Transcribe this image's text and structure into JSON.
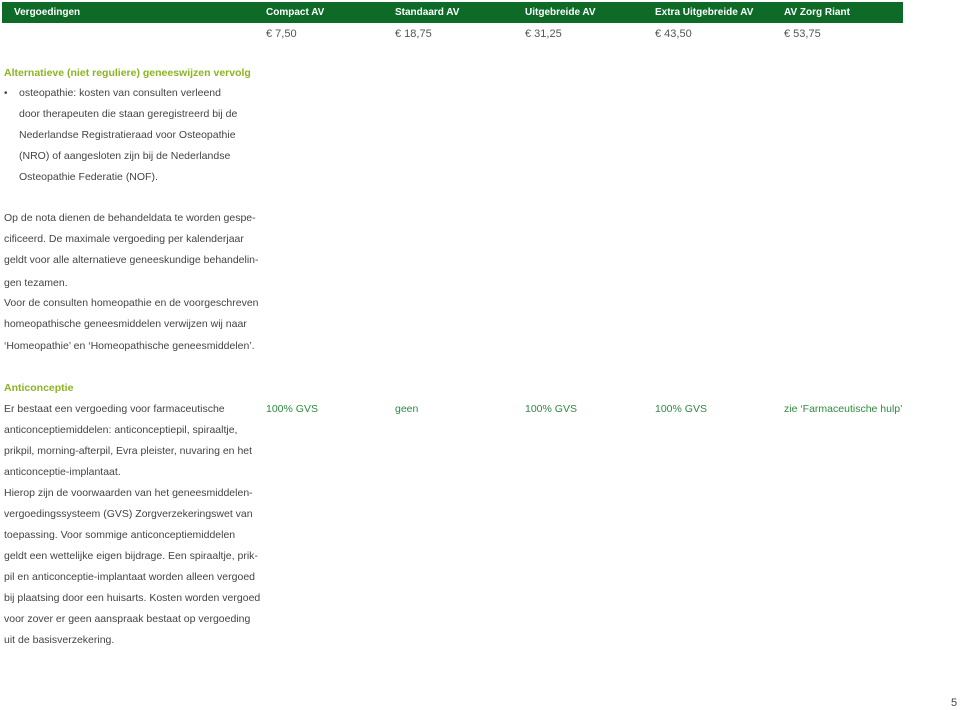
{
  "header": {
    "columns": [
      "Vergoedingen",
      "Compact AV",
      "Standaard AV",
      "Uitgebreide AV",
      "Extra Uitgebreide AV",
      "AV Zorg Riant"
    ],
    "color": "#0d6b27"
  },
  "prices": [
    "€ 7,50",
    "€ 18,75",
    "€ 31,25",
    "€ 43,50",
    "€ 53,75"
  ],
  "section1": {
    "title": "Alternatieve (niet reguliere) geneeswijzen vervolg",
    "bullet_lines": [
      "osteopathie: kosten van consulten verleend",
      "door therapeuten die staan geregistreerd bij de",
      "Nederlandse Registratieraad voor Osteopathie",
      "(NRO) of aangesloten zijn bij de Nederlandse",
      "Osteopathie Federatie (NOF)."
    ],
    "paragraph_lines": [
      "Op de nota dienen de behandeldata te worden gespe-",
      "cificeerd. De maximale vergoeding per kalenderjaar",
      "geldt voor alle alternatieve geneeskundige behandelin-",
      "gen tezamen.",
      "Voor de consulten homeopathie en de voorgeschreven",
      "homeopathische geneesmiddelen verwijzen wij naar",
      "‘Homeopathie’ en ‘Homeopathische geneesmiddelen’."
    ]
  },
  "section2": {
    "title": "Anticonceptie",
    "lines": [
      "Er bestaat een vergoeding voor farmaceutische",
      "anticonceptiemiddelen: anticonceptiepil, spiraaltje,",
      "prikpil, morning-afterpil, Evra pleister, nuvaring en het",
      "anticonceptie-implantaat.",
      "Hierop zijn de voorwaarden van het geneesmiddelen-",
      "vergoedingssysteem (GVS) Zorgverzekeringswet van",
      "toepassing. Voor sommige anticonceptiemiddelen",
      "geldt een wettelijke eigen bijdrage. Een spiraaltje, prik-",
      "pil en anticonceptie-implantaat worden alleen vergoed",
      "bij plaatsing door een huisarts. Kosten worden vergoed",
      "voor zover er geen aanspraak bestaat op vergoeding",
      "uit de basisverzekering."
    ],
    "values": [
      "100% GVS",
      "geen",
      "100% GVS",
      "100% GVS",
      "zie ‘Farmaceutische hulp’"
    ]
  },
  "page_number": "5"
}
